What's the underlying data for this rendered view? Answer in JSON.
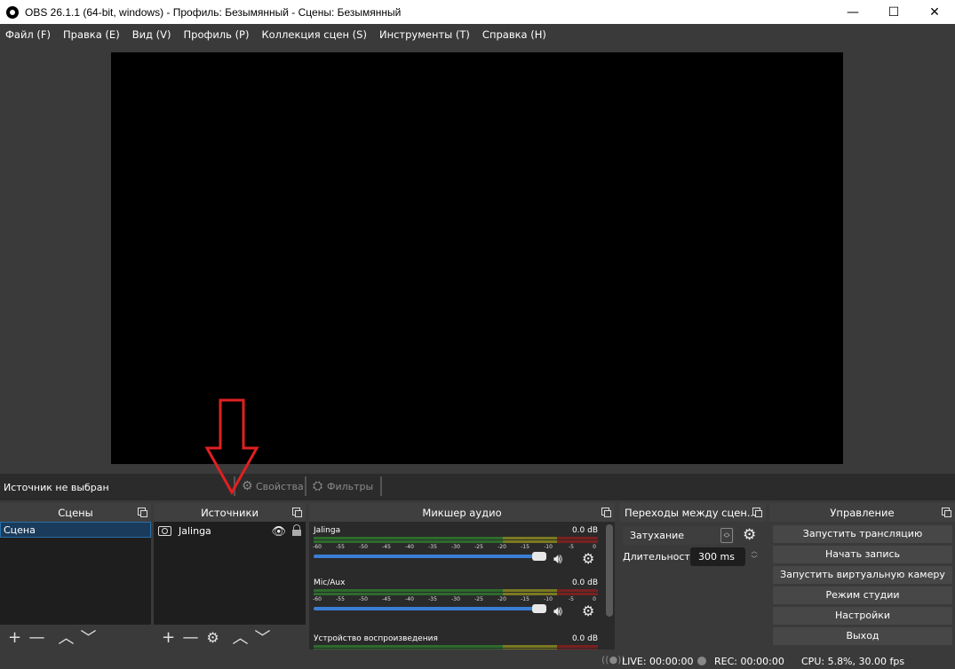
{
  "window": {
    "title": "OBS 26.1.1 (64-bit, windows) - Профиль: Безымянный - Сцены: Безымянный",
    "minimize": "—",
    "maximize": "☐",
    "close": "✕"
  },
  "menu": [
    {
      "label": "Файл (F)"
    },
    {
      "label": "Правка (E)"
    },
    {
      "label": "Вид (V)"
    },
    {
      "label": "Профиль (P)"
    },
    {
      "label": "Коллекция сцен (S)"
    },
    {
      "label": "Инструменты (T)"
    },
    {
      "label": "Справка (H)"
    }
  ],
  "context_bar": {
    "no_source": "Источник не выбран",
    "properties": "Свойства",
    "filters": "Фильтры"
  },
  "scenes": {
    "title": "Сцены",
    "items": [
      "Сцена"
    ]
  },
  "sources": {
    "title": "Источники",
    "items": [
      {
        "name": "Jalinga",
        "type_icon": "camera-icon",
        "visible": true,
        "locked": false
      }
    ]
  },
  "mixer": {
    "title": "Микшер аудио",
    "channels": [
      {
        "name": "Jalinga",
        "db": "0.0 dB",
        "volume_percent": 100,
        "muted": false
      },
      {
        "name": "Mic/Aux",
        "db": "0.0 dB",
        "volume_percent": 100,
        "muted": false
      },
      {
        "name": "Устройство воспроизведения",
        "db": "0.0 dB",
        "volume_percent": 100,
        "muted": false
      }
    ],
    "ticks": [
      "-60",
      "-55",
      "-50",
      "-45",
      "-40",
      "-35",
      "-30",
      "-25",
      "-20",
      "-15",
      "-10",
      "-5",
      "0"
    ]
  },
  "transitions": {
    "title": "Переходы между сцен...",
    "selected": "Затухание",
    "duration_label": "Длительность",
    "duration_value": "300 ms"
  },
  "controls": {
    "title": "Управление",
    "buttons": [
      "Запустить трансляцию",
      "Начать запись",
      "Запустить виртуальную камеру",
      "Режим студии",
      "Настройки",
      "Выход"
    ]
  },
  "status": {
    "live": "LIVE: 00:00:00",
    "rec": "REC: 00:00:00",
    "cpu": "CPU: 5.8%, 30.00 fps"
  },
  "colors": {
    "accent": "#3a7fd5",
    "annotation": "#e02020",
    "meter_green": "#2d6b2d",
    "meter_yellow": "#7a7a20",
    "meter_red": "#7a2020"
  }
}
